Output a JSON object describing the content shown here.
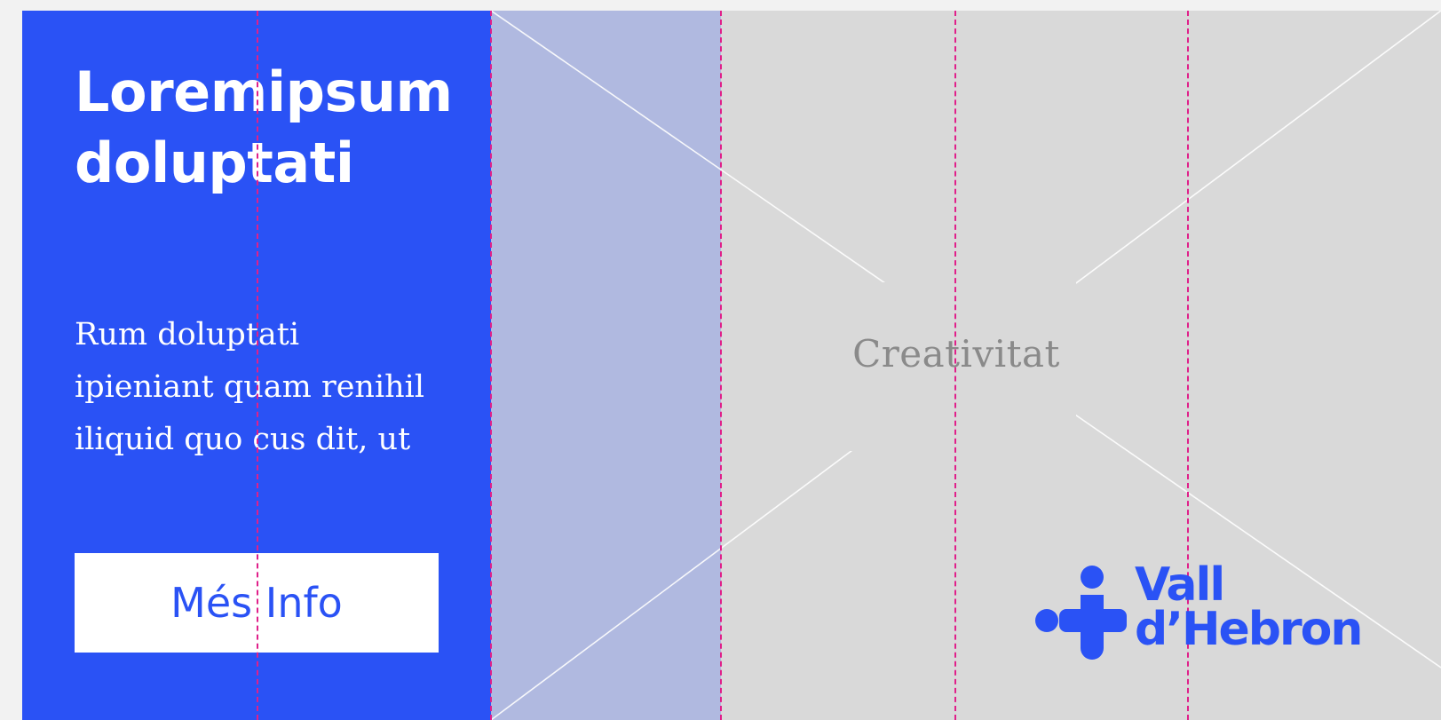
{
  "headline": {
    "line1": "Loremipsum",
    "line2": "doluptati"
  },
  "body": {
    "line1": "Rum doluptati",
    "line2": "ipieniant quam renihil",
    "line3": "iliquid quo cus dit, ut"
  },
  "cta": {
    "label": "Més Info"
  },
  "image_placeholder": {
    "label": "Creativitat"
  },
  "logo": {
    "line1": "Vall",
    "line2": "d’Hebron",
    "icon": "vall-hebron-cross-icon"
  },
  "colors": {
    "brand_blue": "#2a52f5",
    "guide_magenta": "#e0208a",
    "placeholder_gray": "#d9d9d9",
    "tint_lavender": "#b0b9e0"
  }
}
